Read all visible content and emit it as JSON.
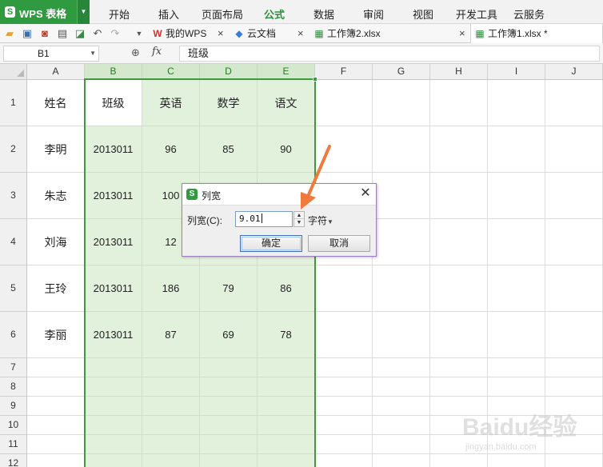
{
  "app": {
    "title": "WPS 表格",
    "accent": "#2f9a3f"
  },
  "menu": [
    "开始",
    "插入",
    "页面布局",
    "公式",
    "数据",
    "审阅",
    "视图",
    "开发工具",
    "云服务"
  ],
  "menu_active": "公式",
  "tabs": [
    {
      "label": "我的WPS",
      "icon": "wps-icon"
    },
    {
      "label": "云文档",
      "icon": "cloud-cube-icon"
    },
    {
      "label": "工作簿2.xlsx",
      "icon": "spreadsheet-icon"
    },
    {
      "label": "工作簿1.xlsx *",
      "icon": "spreadsheet-icon",
      "active": true
    }
  ],
  "formula_bar": {
    "cell_ref": "B1",
    "content": "班级"
  },
  "columns": [
    "A",
    "B",
    "C",
    "D",
    "E",
    "F",
    "G",
    "H",
    "I",
    "J"
  ],
  "selected_columns": [
    "B",
    "C",
    "D",
    "E"
  ],
  "rows": [
    "1",
    "2",
    "3",
    "4",
    "5",
    "6",
    "7",
    "8",
    "9",
    "10",
    "11",
    "12"
  ],
  "table": {
    "header": [
      "姓名",
      "班级",
      "英语",
      "数学",
      "语文"
    ],
    "body": [
      [
        "李明",
        "2013011",
        "96",
        "85",
        "90"
      ],
      [
        "朱志",
        "2013011",
        "100",
        "",
        ""
      ],
      [
        "刘海",
        "2013011",
        "12",
        "",
        ""
      ],
      [
        "王玲",
        "2013011",
        "186",
        "79",
        "86"
      ],
      [
        "李丽",
        "2013011",
        "87",
        "69",
        "78"
      ]
    ]
  },
  "dialog": {
    "title": "列宽",
    "label": "列宽(C):",
    "value": "9.01",
    "unit": "字符",
    "ok": "确定",
    "cancel": "取消"
  },
  "watermark": {
    "text": "Baidu经验",
    "sub": "jingyan.baidu.com"
  },
  "colors": {
    "selection_fill": "#e2f1dc",
    "selection_border": "#3f9a3f",
    "arrow": "#f07a3c"
  }
}
